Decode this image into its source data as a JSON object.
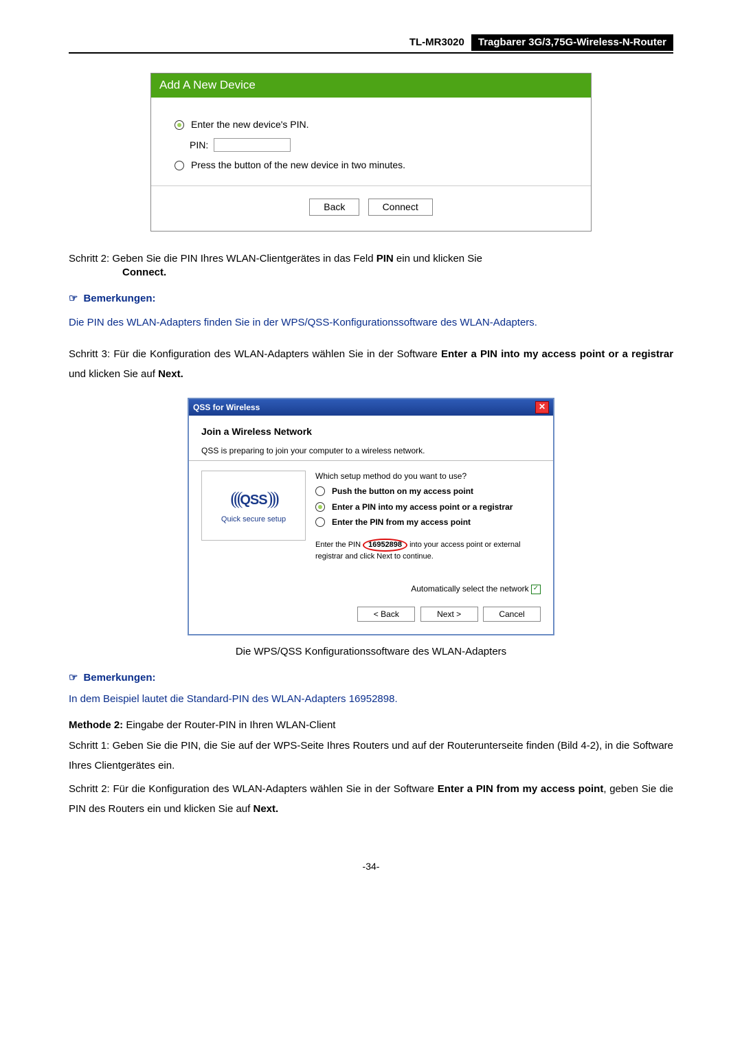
{
  "header": {
    "model": "TL-MR3020",
    "product": "Tragbarer 3G/3,75G-Wireless-N-Router"
  },
  "addDevice": {
    "title": "Add A New Device",
    "opt1": "Enter the new device's PIN.",
    "pinLabel": "PIN:",
    "opt2": "Press the button of the new device in two minutes.",
    "back": "Back",
    "connect": "Connect"
  },
  "step2": {
    "pre": "Schritt 2:",
    "text1": "Geben Sie die PIN Ihres WLAN-Clientgerätes in das Feld ",
    "pin": "PIN",
    "text2": " ein und klicken Sie ",
    "connect": "Connect."
  },
  "notes": {
    "label": "Bemerkungen:"
  },
  "note1": "Die PIN des WLAN-Adapters finden Sie in der WPS/QSS-Konfigurationssoftware des WLAN-Adapters.",
  "step3": {
    "pre": "Schritt 3:",
    "text1": "Für die Konfiguration des WLAN-Adapters wählen Sie in der Software ",
    "bold1": "Enter a PIN into my access point or a registrar",
    "text2": " und klicken Sie auf ",
    "bold2": "Next."
  },
  "qss": {
    "title": "QSS for Wireless",
    "join": "Join a Wireless Network",
    "sub": "QSS is preparing to join your computer to a wireless network.",
    "logoText": "QSS",
    "logoCap": "Quick secure setup",
    "which": "Which setup method do you want to use?",
    "o1": "Push the button on my access point",
    "o2": "Enter a PIN into my access point or a registrar",
    "o3": "Enter the PIN from my access point",
    "pinTextA": "Enter the PIN ",
    "pinNum": "16952898",
    "pinTextB": " into your access point or external registrar and click Next to continue.",
    "auto": "Automatically select the network",
    "back": "< Back",
    "next": "Next >",
    "cancel": "Cancel"
  },
  "caption": "Die WPS/QSS Konfigurationssoftware des WLAN-Adapters",
  "note2": "In dem Beispiel lautet die Standard-PIN des WLAN-Adapters 16952898.",
  "methode2": {
    "bold": "Methode 2:",
    "rest": " Eingabe der Router-PIN in Ihren WLAN-Client"
  },
  "m2s1": {
    "pre": "Schritt 1:",
    "text": "Geben Sie die PIN, die Sie auf der WPS-Seite Ihres Routers und auf der Routerunterseite finden (Bild 4-2), in die Software Ihres Clientgerätes ein."
  },
  "m2s2": {
    "pre": "Schritt 2:",
    "t1": "Für die Konfiguration des WLAN-Adapters wählen Sie in der Software ",
    "b1": "Enter a PIN from my access point",
    "t2": ", geben Sie die PIN des Routers ein und klicken Sie auf ",
    "b2": "Next."
  },
  "page": "-34-"
}
